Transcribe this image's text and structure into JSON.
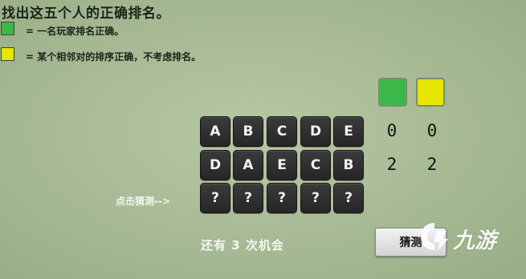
{
  "title": "找出这五个人的正确排名。",
  "legend": [
    {
      "color": "#3cb84a",
      "text": "=  一名玩家排名正确。"
    },
    {
      "color": "#e6e600",
      "text": "=  某个相邻对的排序正确，不考虑排名。"
    }
  ],
  "feedback_headers": [
    {
      "color": "#3cb84a",
      "name": "green"
    },
    {
      "color": "#e6e600",
      "name": "yellow"
    }
  ],
  "guesses": [
    {
      "letters": [
        "A",
        "B",
        "C",
        "D",
        "E"
      ],
      "green": "0",
      "yellow": "0"
    },
    {
      "letters": [
        "D",
        "A",
        "E",
        "C",
        "B"
      ],
      "green": "2",
      "yellow": "2"
    }
  ],
  "input_row": [
    "?",
    "?",
    "?",
    "?",
    "?"
  ],
  "hint": "点击猜测-->",
  "remaining": "还有  3  次机会",
  "guess_button": "猜测",
  "watermark": {
    "text": "九游",
    "icon": "jiuyou-logo-icon"
  }
}
